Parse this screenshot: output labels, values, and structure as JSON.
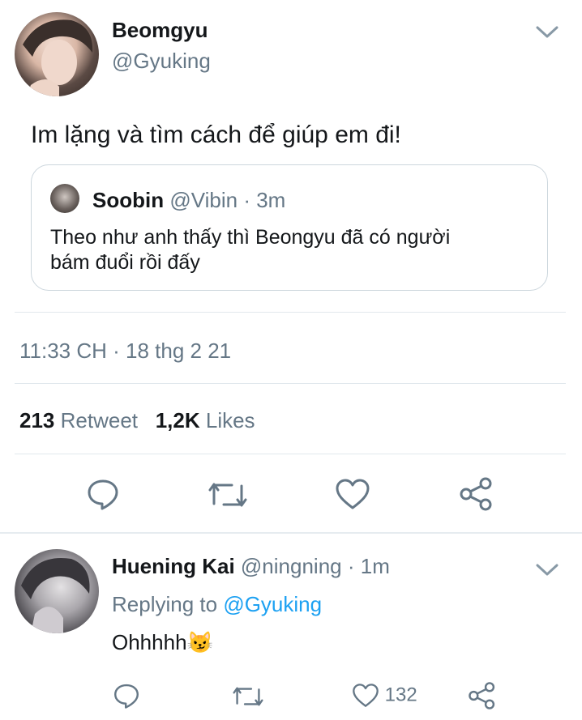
{
  "main_tweet": {
    "display_name": "Beomgyu",
    "handle": "@Gyuking",
    "text": "Im lặng và tìm cách để giúp em đi!",
    "quoted": {
      "display_name": "Soobin",
      "handle": "@Vibin",
      "time": "· 3m",
      "text_line1": "Theo như anh thấy thì Beongyu đã có người",
      "text_line2": "bám đuổi rồi đấy"
    },
    "timestamp": "11:33 CH · 18 thg 2 21",
    "retweet_count": "213",
    "retweet_label": "Retweet",
    "like_count": "1,2K",
    "like_label": "Likes"
  },
  "reply": {
    "display_name": "Huening Kai",
    "handle": "@ningning",
    "time": "· 1m",
    "replying_label": "Replying to",
    "replying_handle": "@Gyuking",
    "text": "Ohhhhh",
    "emoji": "😼",
    "like_count": "132"
  },
  "colors": {
    "accent": "#1da1f2",
    "muted": "#657786",
    "text": "#14171a",
    "divider": "#e1e8ed"
  },
  "icons": [
    "chevron-down-icon",
    "reply-icon",
    "retweet-icon",
    "like-icon",
    "share-icon"
  ]
}
